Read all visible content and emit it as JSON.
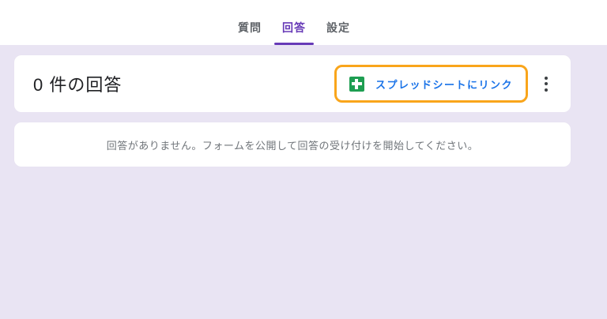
{
  "page": {
    "background_color": "#e9e4f3",
    "header_background": "#ffffff"
  },
  "tabs": {
    "items": [
      {
        "label": "質問",
        "active": false
      },
      {
        "label": "回答",
        "active": true
      },
      {
        "label": "設定",
        "active": false
      }
    ],
    "active_color": "#673ab7",
    "inactive_color": "#5f6368"
  },
  "responses_card": {
    "title": "0 件の回答",
    "link_button": {
      "label": "スプレッドシートにリンク",
      "icon": "sheets-icon",
      "icon_color": "#1e9e52",
      "text_color": "#1a73e8"
    },
    "highlight_color": "#f9a51b",
    "more_menu_icon": "kebab-menu-icon"
  },
  "empty_card": {
    "message": "回答がありません。フォームを公開して回答の受け付けを開始してください。"
  }
}
